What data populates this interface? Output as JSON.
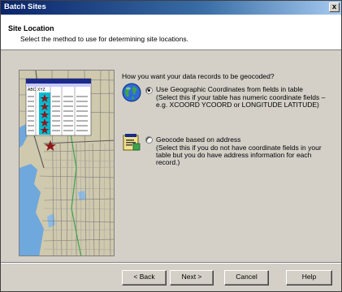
{
  "window": {
    "title": "Batch Sites",
    "close_glyph": "x"
  },
  "header": {
    "title": "Site Location",
    "subtitle": "Select the method to use for determining site locations."
  },
  "preview": {
    "column_labels": [
      "ABC",
      "XYZ"
    ]
  },
  "question": "How you want your data records to be geocoded?",
  "options": [
    {
      "label": "Use Geographic Coordinates from fields in table",
      "desc_lines": [
        "(Select this if your table has numeric coordinate fields –",
        "e.g. XCOORD YCOORD or LONGITUDE LATITUDE)"
      ],
      "selected": true,
      "icon": "globe-icon"
    },
    {
      "label": "Geocode based on address",
      "desc_lines": [
        "(Select this if you do not have coordinate fields in your",
        "table but you do have address information for each",
        "record.)"
      ],
      "selected": false,
      "icon": "address-document-icon"
    }
  ],
  "buttons": {
    "back": "< Back",
    "next": "Next >",
    "cancel": "Cancel",
    "help": "Help"
  },
  "colors": {
    "title_start": "#0a246a",
    "title_end": "#a6caf0",
    "map_water": "#6fa8dc",
    "table_header": "#1a2a8a",
    "star": "#8b1a1a"
  }
}
